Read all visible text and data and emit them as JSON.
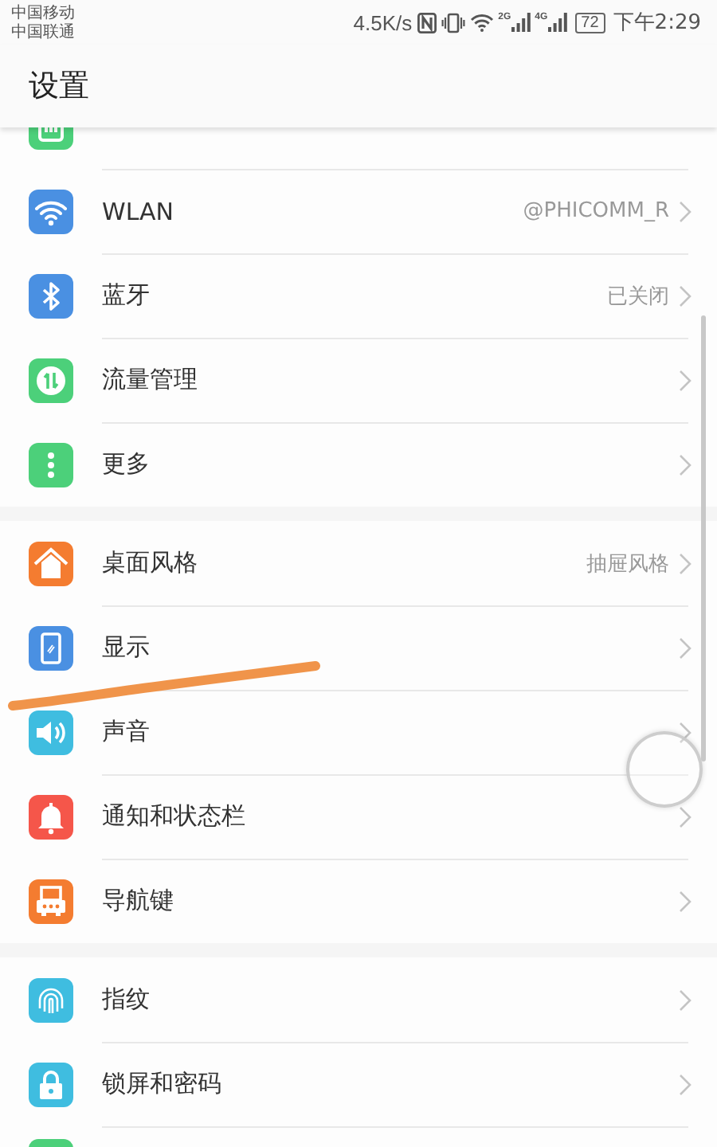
{
  "status_bar": {
    "carriers": [
      "中国移动",
      "中国联通"
    ],
    "net_speed": "4.5K/s",
    "signals": [
      {
        "label": "2G"
      },
      {
        "label": "4G"
      }
    ],
    "battery": "72",
    "time": "下午2:29"
  },
  "header": {
    "title": "设置"
  },
  "groups": [
    {
      "items": [
        {
          "kind": "sim",
          "color": "#4cd07a"
        },
        {
          "kind": "wifi",
          "color": "#4a90e2",
          "label": "WLAN",
          "value": "@PHICOMM_R"
        },
        {
          "kind": "bluetooth",
          "color": "#4a90e2",
          "label": "蓝牙",
          "value": "已关闭"
        },
        {
          "kind": "data",
          "color": "#4cd07a",
          "label": "流量管理"
        },
        {
          "kind": "more",
          "color": "#4cd07a",
          "label": "更多"
        }
      ]
    },
    {
      "items": [
        {
          "kind": "home",
          "color": "#f47c30",
          "label": "桌面风格",
          "value": "抽屉风格"
        },
        {
          "kind": "display",
          "color": "#4a90e2",
          "label": "显示"
        },
        {
          "kind": "sound",
          "color": "#3fbde0",
          "label": "声音"
        },
        {
          "kind": "bell",
          "color": "#f5564a",
          "label": "通知和状态栏"
        },
        {
          "kind": "navkey",
          "color": "#f47c30",
          "label": "导航键"
        }
      ]
    },
    {
      "items": [
        {
          "kind": "fingerprint",
          "color": "#3fbde0",
          "label": "指纹"
        },
        {
          "kind": "lock",
          "color": "#3fbde0",
          "label": "锁屏和密码"
        },
        {
          "kind": "blank",
          "color": "#4cd07a"
        }
      ]
    }
  ]
}
